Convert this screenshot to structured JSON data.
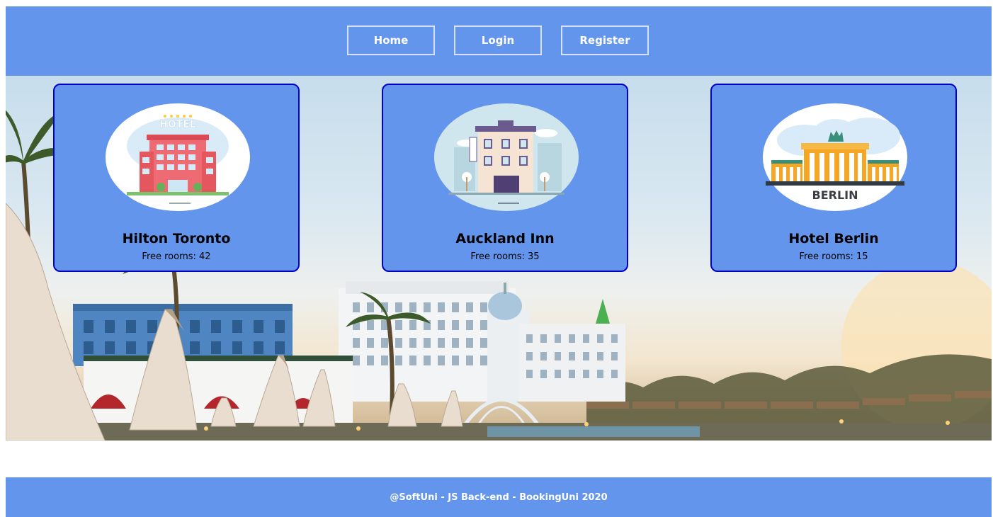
{
  "nav": {
    "home_label": "Home",
    "login_label": "Login",
    "register_label": "Register"
  },
  "hotels": [
    {
      "name": "Hilton Toronto",
      "rooms_label": "Free rooms: 42",
      "image_icon": "hotel-building-icon",
      "image_text": "HOTEL"
    },
    {
      "name": "Auckland Inn",
      "rooms_label": "Free rooms: 35",
      "image_icon": "inn-building-icon",
      "image_text": "HOTEL"
    },
    {
      "name": "Hotel Berlin",
      "rooms_label": "Free rooms: 15",
      "image_icon": "brandenburg-gate-icon",
      "image_text": "BERLIN"
    }
  ],
  "footer": {
    "text": "@SoftUni - JS Back-end - BookingUni 2020"
  },
  "colors": {
    "primary": "#6495ed",
    "card_border": "#0000cd",
    "nav_border": "#d6e2fa"
  }
}
